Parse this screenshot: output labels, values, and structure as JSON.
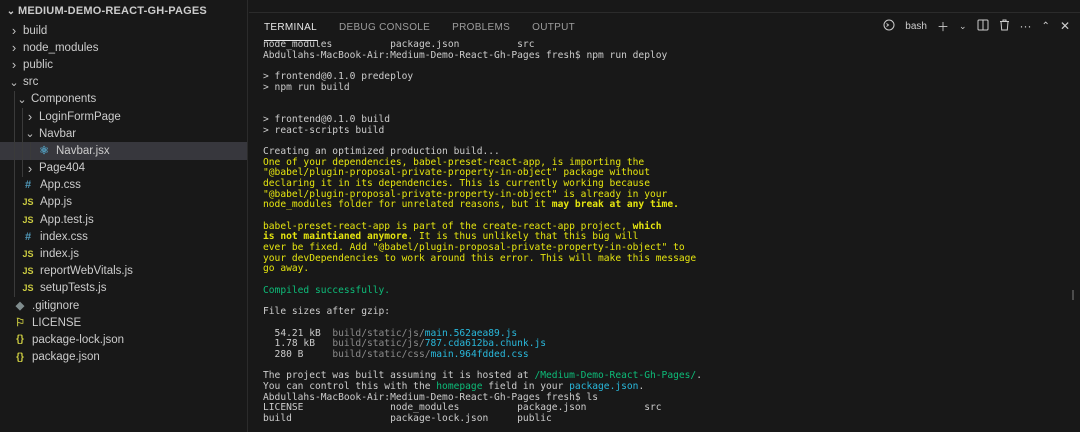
{
  "explorer": {
    "project_title": "MEDIUM-DEMO-REACT-GH-PAGES",
    "items": [
      {
        "label": "build",
        "kind": "folder",
        "depth": 1,
        "open": false
      },
      {
        "label": "node_modules",
        "kind": "folder",
        "depth": 1,
        "open": false
      },
      {
        "label": "public",
        "kind": "folder",
        "depth": 1,
        "open": false
      },
      {
        "label": "src",
        "kind": "folder",
        "depth": 1,
        "open": true
      },
      {
        "label": "Components",
        "kind": "folder",
        "depth": 2,
        "open": true
      },
      {
        "label": "LoginFormPage",
        "kind": "folder",
        "depth": 3,
        "open": false
      },
      {
        "label": "Navbar",
        "kind": "folder",
        "depth": 3,
        "open": true
      },
      {
        "label": "Navbar.jsx",
        "kind": "jsx",
        "depth": 4,
        "selected": true
      },
      {
        "label": "Page404",
        "kind": "folder",
        "depth": 3,
        "open": false
      },
      {
        "label": "App.css",
        "kind": "css",
        "depth": 2
      },
      {
        "label": "App.js",
        "kind": "js",
        "depth": 2
      },
      {
        "label": "App.test.js",
        "kind": "js",
        "depth": 2
      },
      {
        "label": "index.css",
        "kind": "css",
        "depth": 2
      },
      {
        "label": "index.js",
        "kind": "js",
        "depth": 2
      },
      {
        "label": "reportWebVitals.js",
        "kind": "js",
        "depth": 2
      },
      {
        "label": "setupTests.js",
        "kind": "js",
        "depth": 2
      },
      {
        "label": ".gitignore",
        "kind": "git",
        "depth": 1
      },
      {
        "label": "LICENSE",
        "kind": "license",
        "depth": 1
      },
      {
        "label": "package-lock.json",
        "kind": "json",
        "depth": 1
      },
      {
        "label": "package.json",
        "kind": "json",
        "depth": 1
      }
    ]
  },
  "panel": {
    "tabs": [
      "TERMINAL",
      "DEBUG CONSOLE",
      "PROBLEMS",
      "OUTPUT"
    ],
    "active_tab": "TERMINAL",
    "shell_label": "bash",
    "icons": {
      "shell": "terminal-icon",
      "new": "plus-icon",
      "dropdown": "chevron-down-icon",
      "split": "split-icon",
      "kill": "trash-icon",
      "more": "ellipsis-icon",
      "maximize": "chevron-up-icon",
      "close": "close-icon"
    }
  },
  "terminal": {
    "lines": [
      [
        {
          "t": "node_modules          package.json          src"
        }
      ],
      [
        {
          "t": "Abdullahs-MacBook-Air:Medium-Demo-React-Gh-Pages fresh$ npm run deploy"
        }
      ],
      [
        {
          "t": ""
        }
      ],
      [
        {
          "t": "> frontend@0.1.0 predeploy"
        }
      ],
      [
        {
          "t": "> npm run build"
        }
      ],
      [
        {
          "t": ""
        }
      ],
      [
        {
          "t": ""
        }
      ],
      [
        {
          "t": "> frontend@0.1.0 build"
        }
      ],
      [
        {
          "t": "> react-scripts build"
        }
      ],
      [
        {
          "t": ""
        }
      ],
      [
        {
          "t": "Creating an optimized production build..."
        }
      ],
      [
        {
          "t": "One of your dependencies, babel-preset-react-app, is importing the",
          "c": "yellow"
        }
      ],
      [
        {
          "t": "\"@babel/plugin-proposal-private-property-in-object\" package without",
          "c": "yellow"
        }
      ],
      [
        {
          "t": "declaring it in its dependencies. This is currently working because",
          "c": "yellow"
        }
      ],
      [
        {
          "t": "\"@babel/plugin-proposal-private-property-in-object\" is already in your",
          "c": "yellow"
        }
      ],
      [
        {
          "t": "node_modules folder for unrelated reasons, but it ",
          "c": "yellow"
        },
        {
          "t": "may break at any time.",
          "c": "yellow-b"
        }
      ],
      [
        {
          "t": ""
        }
      ],
      [
        {
          "t": "babel-preset-react-app is part of the create-react-app project, ",
          "c": "yellow"
        },
        {
          "t": "which",
          "c": "yellow-b"
        }
      ],
      [
        {
          "t": "is not maintianed anymore",
          "c": "yellow-b"
        },
        {
          "t": ". It is thus unlikely that this bug will",
          "c": "yellow"
        }
      ],
      [
        {
          "t": "ever be fixed. Add \"@babel/plugin-proposal-private-property-in-object\" to",
          "c": "yellow"
        }
      ],
      [
        {
          "t": "your devDependencies to work around this error. This will make this message",
          "c": "yellow"
        }
      ],
      [
        {
          "t": "go away.",
          "c": "yellow"
        }
      ],
      [
        {
          "t": ""
        }
      ],
      [
        {
          "t": "Compiled successfully.",
          "c": "green"
        }
      ],
      [
        {
          "t": ""
        }
      ],
      [
        {
          "t": "File sizes after gzip:"
        }
      ],
      [
        {
          "t": ""
        }
      ],
      [
        {
          "t": "  54.21 kB  "
        },
        {
          "t": "build/static/js/",
          "c": "dim"
        },
        {
          "t": "main.562aea89.js",
          "c": "cyan"
        }
      ],
      [
        {
          "t": "  1.78 kB   "
        },
        {
          "t": "build/static/js/",
          "c": "dim"
        },
        {
          "t": "787.cda612ba.chunk.js",
          "c": "cyan"
        }
      ],
      [
        {
          "t": "  280 B     "
        },
        {
          "t": "build/static/css/",
          "c": "dim"
        },
        {
          "t": "main.964fdded.css",
          "c": "cyan"
        }
      ],
      [
        {
          "t": ""
        }
      ],
      [
        {
          "t": "The project was built assuming it is hosted at "
        },
        {
          "t": "/Medium-Demo-React-Gh-Pages/",
          "c": "green"
        },
        {
          "t": "."
        }
      ],
      [
        {
          "t": "You can control this with the "
        },
        {
          "t": "homepage",
          "c": "green"
        },
        {
          "t": " field in your "
        },
        {
          "t": "package.json",
          "c": "cyan"
        },
        {
          "t": "."
        }
      ],
      [
        {
          "t": "Abdullahs-MacBook-Air:Medium-Demo-React-Gh-Pages fresh$ ls"
        }
      ],
      [
        {
          "t": "LICENSE               node_modules          package.json          src"
        }
      ],
      [
        {
          "t": "build                 package-lock.json     public"
        }
      ]
    ]
  }
}
